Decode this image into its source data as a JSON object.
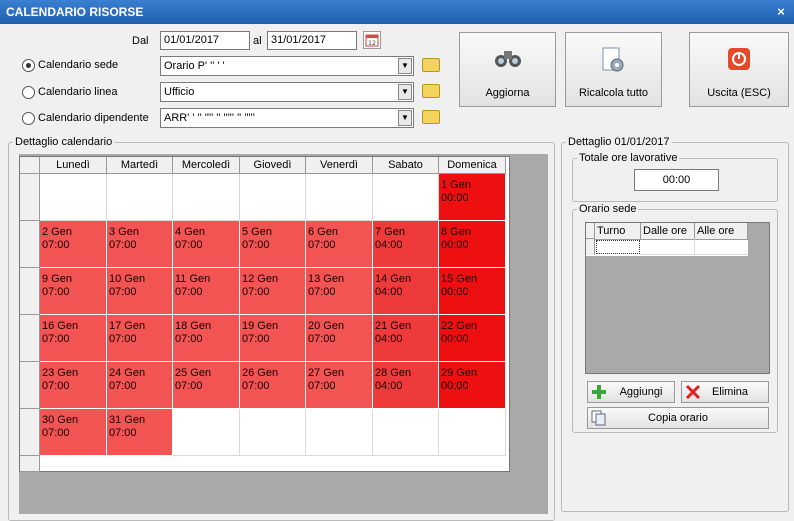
{
  "window": {
    "title": "CALENDARIO RISORSE",
    "close_glyph": "×"
  },
  "filters": {
    "dal_label": "Dal",
    "dal_value": "01/01/2017",
    "al_label": "al",
    "al_value": "31/01/2017",
    "calendar_icon": "calendar-picker-icon",
    "options": [
      {
        "label": "Calendario sede",
        "selected": true,
        "combo_value": "Orario P' '' ' '"
      },
      {
        "label": "Calendario linea",
        "selected": false,
        "combo_value": "Ufficio"
      },
      {
        "label": "Calendario dipendente",
        "selected": false,
        "combo_value": "ARR'  ' '' '''' '' ''''' '' '''''"
      }
    ]
  },
  "buttons": {
    "aggiorna": "Aggiorna",
    "ricalcola": "Ricalcola tutto",
    "uscita": "Uscita (ESC)"
  },
  "calendar": {
    "legend": "Dettaglio calendario",
    "days": [
      "Lunedì",
      "Martedì",
      "Mercoledì",
      "Giovedì",
      "Venerdì",
      "Sabato",
      "Domenica"
    ],
    "weeks": [
      [
        null,
        null,
        null,
        null,
        null,
        null,
        {
          "d": "1 Gen",
          "h": "00:00",
          "t": "off"
        }
      ],
      [
        {
          "d": "2 Gen",
          "h": "07:00",
          "t": "work"
        },
        {
          "d": "3 Gen",
          "h": "07:00",
          "t": "work"
        },
        {
          "d": "4 Gen",
          "h": "07:00",
          "t": "work"
        },
        {
          "d": "5 Gen",
          "h": "07:00",
          "t": "work"
        },
        {
          "d": "6 Gen",
          "h": "07:00",
          "t": "work"
        },
        {
          "d": "7 Gen",
          "h": "04:00",
          "t": "sat"
        },
        {
          "d": "8 Gen",
          "h": "00:00",
          "t": "off"
        }
      ],
      [
        {
          "d": "9 Gen",
          "h": "07:00",
          "t": "work"
        },
        {
          "d": "10 Gen",
          "h": "07:00",
          "t": "work"
        },
        {
          "d": "11 Gen",
          "h": "07:00",
          "t": "work"
        },
        {
          "d": "12 Gen",
          "h": "07:00",
          "t": "work"
        },
        {
          "d": "13 Gen",
          "h": "07:00",
          "t": "work"
        },
        {
          "d": "14 Gen",
          "h": "04:00",
          "t": "sat"
        },
        {
          "d": "15 Gen",
          "h": "00:00",
          "t": "off"
        }
      ],
      [
        {
          "d": "16 Gen",
          "h": "07:00",
          "t": "work"
        },
        {
          "d": "17 Gen",
          "h": "07:00",
          "t": "work"
        },
        {
          "d": "18 Gen",
          "h": "07:00",
          "t": "work"
        },
        {
          "d": "19 Gen",
          "h": "07:00",
          "t": "work"
        },
        {
          "d": "20 Gen",
          "h": "07:00",
          "t": "work"
        },
        {
          "d": "21 Gen",
          "h": "04:00",
          "t": "sat"
        },
        {
          "d": "22 Gen",
          "h": "00:00",
          "t": "off"
        }
      ],
      [
        {
          "d": "23 Gen",
          "h": "07:00",
          "t": "work"
        },
        {
          "d": "24 Gen",
          "h": "07:00",
          "t": "work"
        },
        {
          "d": "25 Gen",
          "h": "07:00",
          "t": "work"
        },
        {
          "d": "26 Gen",
          "h": "07:00",
          "t": "work"
        },
        {
          "d": "27 Gen",
          "h": "07:00",
          "t": "work"
        },
        {
          "d": "28 Gen",
          "h": "04:00",
          "t": "sat"
        },
        {
          "d": "29 Gen",
          "h": "00:00",
          "t": "off"
        }
      ],
      [
        {
          "d": "30 Gen",
          "h": "07:00",
          "t": "work"
        },
        {
          "d": "31 Gen",
          "h": "07:00",
          "t": "work"
        },
        null,
        null,
        null,
        null,
        null
      ]
    ]
  },
  "detail": {
    "legend": "Dettaglio 01/01/2017",
    "totale_legend": "Totale ore lavorative",
    "totale_value": "00:00",
    "orario_legend": "Orario sede",
    "columns": [
      "Turno",
      "Dalle ore",
      "Alle ore"
    ],
    "aggiungi": "Aggiungi",
    "elimina": "Elimina",
    "copia": "Copia orario",
    "icons": {
      "add": "plus-icon",
      "delete": "x-icon",
      "copy": "copy-icon"
    }
  },
  "colors": {
    "work": "#f25353",
    "saturday": "#ee3a3a",
    "sunday": "#ee1010",
    "title": "#2a6fc4"
  }
}
